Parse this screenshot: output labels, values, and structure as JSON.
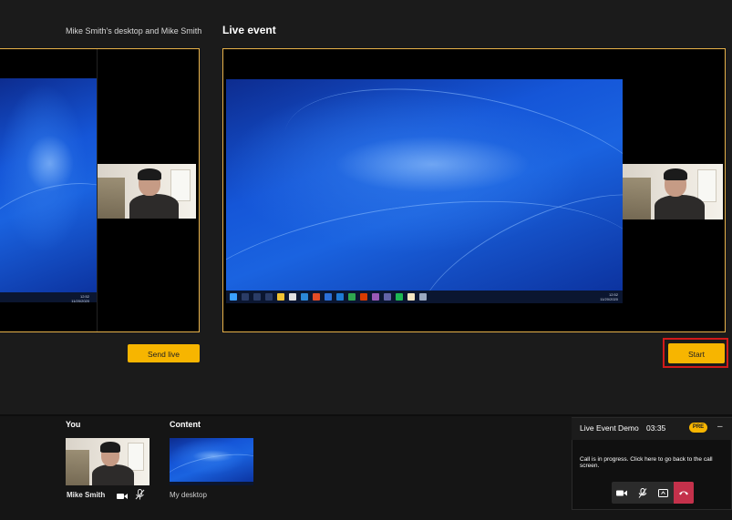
{
  "queue": {
    "title": "Mike Smith's desktop and Mike Smith",
    "send_live_label": "Send live"
  },
  "live": {
    "title": "Live event",
    "start_label": "Start"
  },
  "bottom": {
    "you_label": "You",
    "content_label": "Content",
    "you_name": "Mike Smith",
    "content_name": "My desktop"
  },
  "mini_window": {
    "title": "Live Event Demo",
    "time": "03:35",
    "badge": "PRE",
    "minimize": "–",
    "status": "Call is in progress. Click here to go back to the call screen.",
    "controls": [
      "video-icon",
      "mic-off-icon",
      "share-screen-icon",
      "hang-up-icon"
    ]
  },
  "colors": {
    "accent": "#f7b500",
    "frame_border": "#e8b24a",
    "highlight": "#d11a1a",
    "hangup": "#c4314b"
  }
}
